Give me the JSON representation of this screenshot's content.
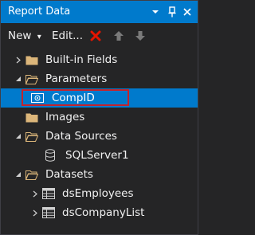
{
  "panel": {
    "title": "Report Data",
    "title_buttons": [
      {
        "icon": "dropdown-arrow-icon",
        "glyph": "▾"
      },
      {
        "icon": "pin-icon",
        "glyph": "📌"
      },
      {
        "icon": "close-icon",
        "glyph": "✕"
      }
    ]
  },
  "toolbar": {
    "new_label": "New",
    "new_arrow": "▾",
    "edit_label": "Edit...",
    "delete_icon": "delete-x-icon",
    "move_up_icon": "arrow-up-icon",
    "move_down_icon": "arrow-down-icon"
  },
  "tree": {
    "builtin_fields": {
      "label": "Built-in Fields",
      "expanded": false,
      "icon": "folder-icon"
    },
    "parameters": {
      "label": "Parameters",
      "expanded": true,
      "icon": "folder-open-icon"
    },
    "compid": {
      "label": "CompID",
      "selected": true,
      "icon": "parameter-icon"
    },
    "images": {
      "label": "Images",
      "icon": "folder-icon"
    },
    "data_sources": {
      "label": "Data Sources",
      "expanded": true,
      "icon": "folder-open-icon"
    },
    "sqlserver1": {
      "label": "SQLServer1",
      "icon": "database-icon"
    },
    "datasets": {
      "label": "Datasets",
      "expanded": true,
      "icon": "folder-open-icon"
    },
    "ds_employees": {
      "label": "dsEmployees",
      "expanded": false,
      "icon": "table-icon"
    },
    "ds_company_list": {
      "label": "dsCompanyList",
      "expanded": false,
      "icon": "table-icon"
    }
  },
  "colors": {
    "accent": "#007acc",
    "panel_bg": "#252526",
    "folder": "#dcb67a",
    "delete": "#e51400",
    "selection_outline": "#c4232b"
  }
}
